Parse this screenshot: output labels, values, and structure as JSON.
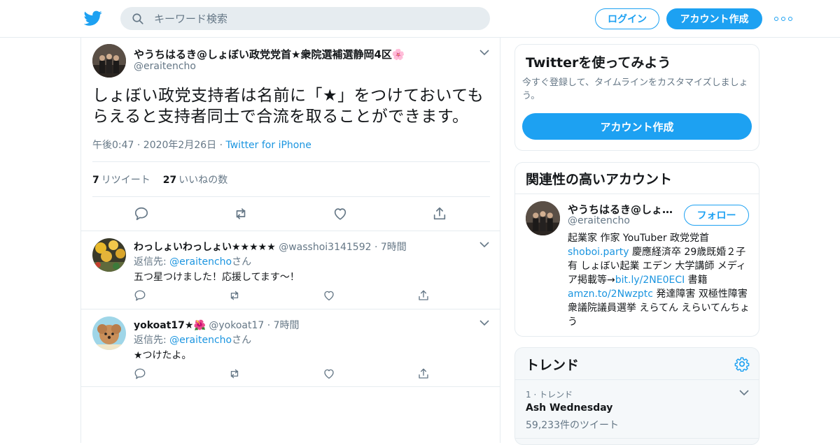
{
  "header": {
    "search_placeholder": "キーワード検索",
    "login_label": "ログイン",
    "signup_label": "アカウント作成"
  },
  "tweet": {
    "name": "やうちはるき@しょぼい政党党首★衆院選補選静岡4区🌸",
    "handle": "@eraitencho",
    "text_line1": "しょぼい政党支持者は名前に「★」をつけておいても",
    "text_line2": "らえると支持者同士で合流を取ることができます。",
    "time": "午後0:47 · 2020年2月26日 · ",
    "source": "Twitter for iPhone",
    "retweet_count": "7",
    "retweet_label": "リツイート",
    "like_count": "27",
    "like_label": "いいねの数"
  },
  "replies": [
    {
      "name": "わっしょいわっしょい★★★★★",
      "handle": "@wasshoi3141592",
      "time": "· 7時間",
      "reply_to_prefix": "返信先: ",
      "reply_to_handle": "@eraitencho",
      "reply_to_suffix": "さん",
      "text": "五つ星つけました！応援してます〜！"
    },
    {
      "name": "yokoat17★🌺",
      "handle": "@yokoat17",
      "time": "· 7時間",
      "reply_to_prefix": "返信先: ",
      "reply_to_handle": "@eraitencho",
      "reply_to_suffix": "さん",
      "text": "★つけたよ。"
    }
  ],
  "sidebar": {
    "try_card": {
      "title": "Twitterを使ってみよう",
      "description": "今すぐ登録して、タイムラインをカスタマイズしましょう。",
      "button": "アカウント作成"
    },
    "related_card": {
      "title": "関連性の高いアカウント",
      "name": "やうちはるき@しょ…",
      "handle": "@eraitencho",
      "follow_label": "フォロー",
      "bio_1": "起業家 作家 YouTuber 政党党首",
      "bio_link1": "shoboi.party",
      "bio_2": " 慶應経済卒 29歳既婚２子有 しょぼい起業 エデン 大学講師 メディア掲載等→",
      "bio_link2": "bit.ly/2NE0ECI",
      "bio_3": " 書籍",
      "bio_link3": "amzn.to/2Nwzptc",
      "bio_4": " 発達障害 双極性障害 衆議院議員選挙 えらてん えらいてんちょう"
    },
    "trends": {
      "title": "トレンド",
      "items": [
        {
          "rank": "1 · トレンド",
          "name": "Ash Wednesday",
          "count": "59,233件のツイート"
        }
      ]
    }
  },
  "colors": {
    "accent": "#1da1f2",
    "link": "#1b95e0",
    "muted": "#657786",
    "border": "#e6ecf0"
  }
}
